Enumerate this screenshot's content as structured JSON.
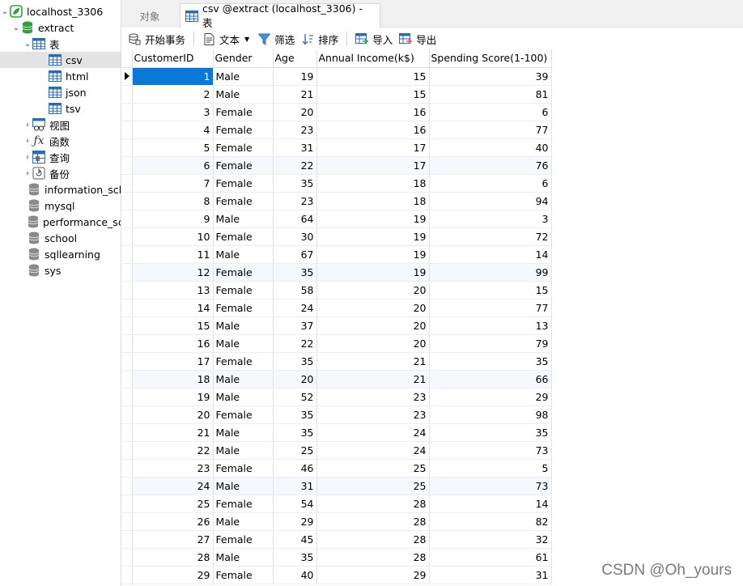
{
  "sidebar": {
    "connection": "localhost_3306",
    "database": "extract",
    "tables_group": "表",
    "tables": [
      "csv",
      "html",
      "json",
      "tsv"
    ],
    "views": "视图",
    "functions": "函数",
    "queries": "查询",
    "backups": "备份",
    "other_databases": [
      "information_schema",
      "mysql",
      "performance_schema",
      "school",
      "sqllearning",
      "sys"
    ]
  },
  "tabs": {
    "objects": "对象",
    "active": "csv @extract (localhost_3306) - 表"
  },
  "toolbar": {
    "begin_transaction": "开始事务",
    "text": "文本",
    "filter": "筛选",
    "sort": "排序",
    "import": "导入",
    "export": "导出"
  },
  "grid": {
    "columns": [
      "CustomerID",
      "Gender",
      "Age",
      "Annual Income(k$)",
      "Spending Score(1-100)"
    ],
    "rows": [
      [
        "1",
        "Male",
        "19",
        "15",
        "39"
      ],
      [
        "2",
        "Male",
        "21",
        "15",
        "81"
      ],
      [
        "3",
        "Female",
        "20",
        "16",
        "6"
      ],
      [
        "4",
        "Female",
        "23",
        "16",
        "77"
      ],
      [
        "5",
        "Female",
        "31",
        "17",
        "40"
      ],
      [
        "6",
        "Female",
        "22",
        "17",
        "76"
      ],
      [
        "7",
        "Female",
        "35",
        "18",
        "6"
      ],
      [
        "8",
        "Female",
        "23",
        "18",
        "94"
      ],
      [
        "9",
        "Male",
        "64",
        "19",
        "3"
      ],
      [
        "10",
        "Female",
        "30",
        "19",
        "72"
      ],
      [
        "11",
        "Male",
        "67",
        "19",
        "14"
      ],
      [
        "12",
        "Female",
        "35",
        "19",
        "99"
      ],
      [
        "13",
        "Female",
        "58",
        "20",
        "15"
      ],
      [
        "14",
        "Female",
        "24",
        "20",
        "77"
      ],
      [
        "15",
        "Male",
        "37",
        "20",
        "13"
      ],
      [
        "16",
        "Male",
        "22",
        "20",
        "79"
      ],
      [
        "17",
        "Female",
        "35",
        "21",
        "35"
      ],
      [
        "18",
        "Male",
        "20",
        "21",
        "66"
      ],
      [
        "19",
        "Male",
        "52",
        "23",
        "29"
      ],
      [
        "20",
        "Female",
        "35",
        "23",
        "98"
      ],
      [
        "21",
        "Male",
        "35",
        "24",
        "35"
      ],
      [
        "22",
        "Male",
        "25",
        "24",
        "73"
      ],
      [
        "23",
        "Female",
        "46",
        "25",
        "5"
      ],
      [
        "24",
        "Male",
        "31",
        "25",
        "73"
      ],
      [
        "25",
        "Female",
        "54",
        "28",
        "14"
      ],
      [
        "26",
        "Male",
        "29",
        "28",
        "82"
      ],
      [
        "27",
        "Female",
        "45",
        "28",
        "32"
      ],
      [
        "28",
        "Male",
        "35",
        "28",
        "61"
      ],
      [
        "29",
        "Female",
        "40",
        "29",
        "31"
      ]
    ]
  },
  "watermark": "CSDN @Oh_yours",
  "colors": {
    "selection": "#0a78d7",
    "db_icon_green": "#2e9e3e",
    "table_icon_blue": "#2b6cb0"
  }
}
